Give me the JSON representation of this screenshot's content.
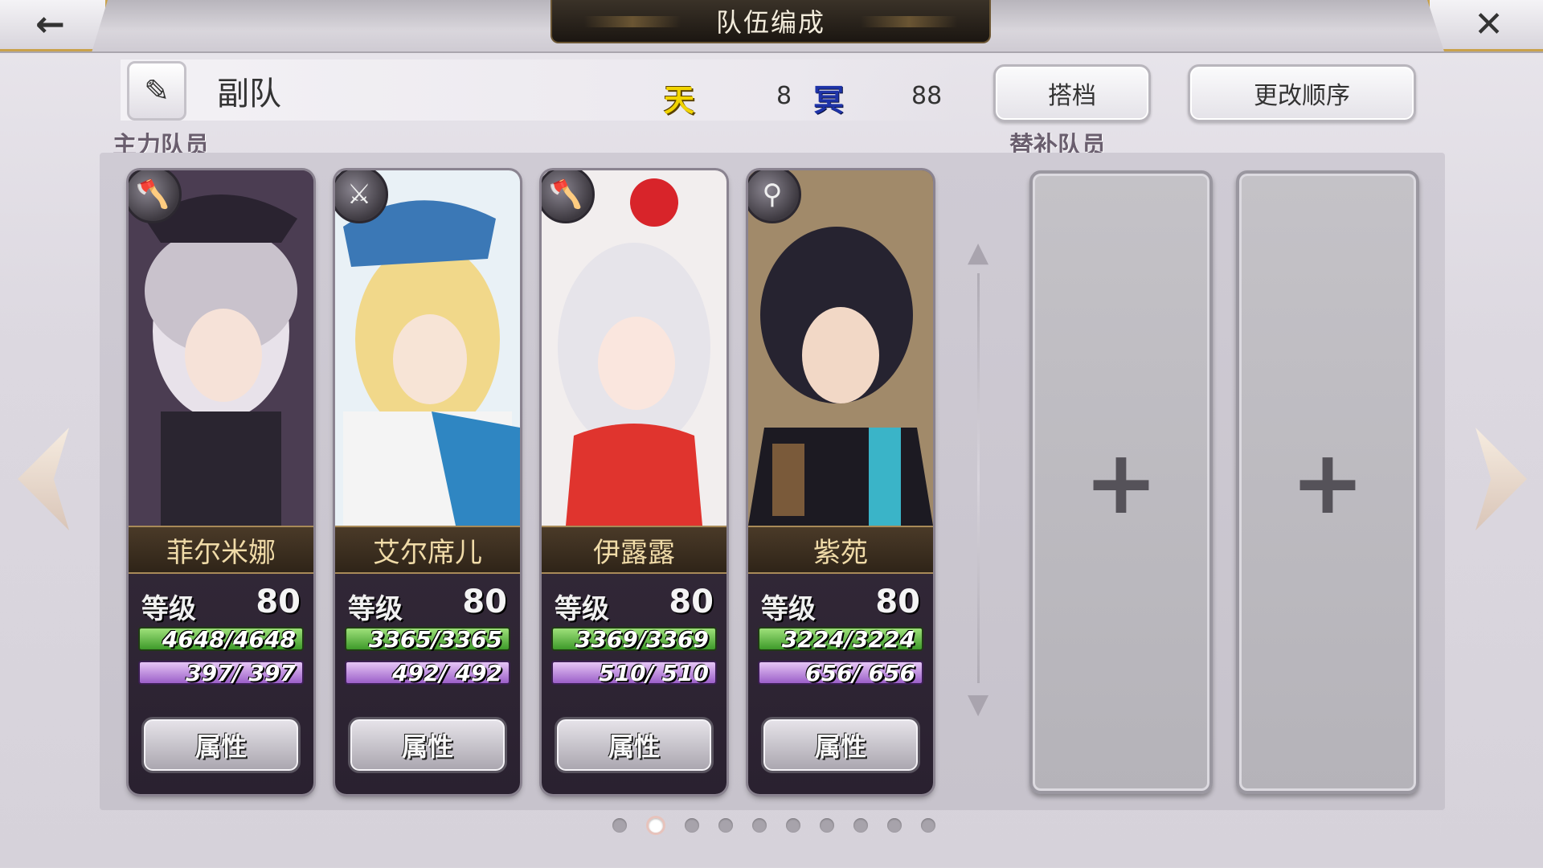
{
  "header": {
    "title": "队伍编成",
    "back_icon": "←",
    "close_icon": "✕"
  },
  "team": {
    "name": "副队",
    "edit_icon": "✎",
    "sky_badge": "天",
    "sky_value": "8",
    "dark_badge": "冥",
    "dark_value": "88",
    "partner_label": "搭档",
    "order_label": "更改顺序"
  },
  "labels": {
    "main_members": "主力队员",
    "sub_members": "替补队员"
  },
  "members": [
    {
      "name": "菲尔米娜",
      "level_label": "等级",
      "level": "80",
      "hp": "4648/4648",
      "mp": "397/  397",
      "attr_label": "属性",
      "weapon_icon": "axe-icon",
      "weapon_glyph": "🪓",
      "accent": "#6a5a8a"
    },
    {
      "name": "艾尔席儿",
      "level_label": "等级",
      "level": "80",
      "hp": "3365/3365",
      "mp": "492/  492",
      "attr_label": "属性",
      "weapon_icon": "sword-icon",
      "weapon_glyph": "⚔",
      "accent": "#3a74b8"
    },
    {
      "name": "伊露露",
      "level_label": "等级",
      "level": "80",
      "hp": "3369/3369",
      "mp": "510/  510",
      "attr_label": "属性",
      "weapon_icon": "axe-icon",
      "weapon_glyph": "🪓",
      "accent": "#c8322e"
    },
    {
      "name": "紫苑",
      "level_label": "等级",
      "level": "80",
      "hp": "3224/3224",
      "mp": "656/  656",
      "attr_label": "属性",
      "weapon_icon": "staff-icon",
      "weapon_glyph": "⚲",
      "accent": "#3b3a44"
    }
  ],
  "reserve_slots": [
    {
      "icon": "+"
    },
    {
      "icon": "+"
    }
  ],
  "pagination": {
    "total": 10,
    "active_index": 1
  }
}
